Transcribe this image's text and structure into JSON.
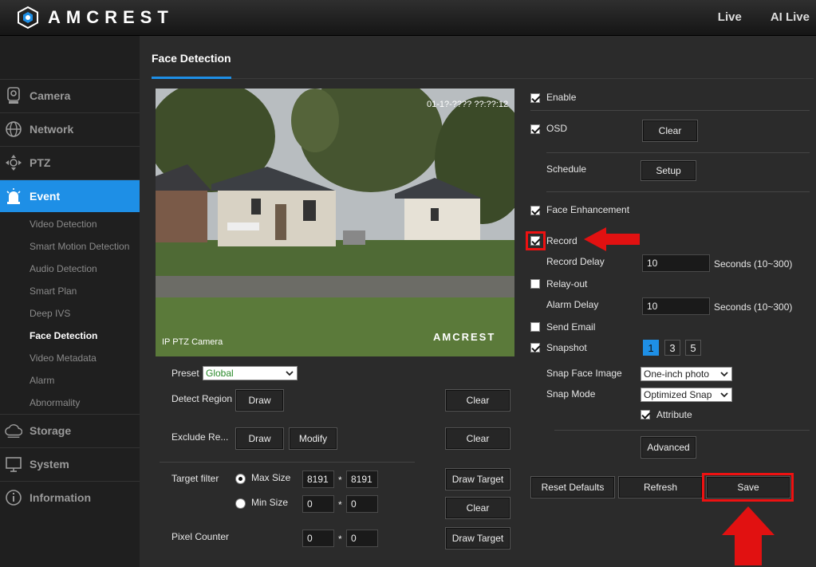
{
  "brand": "AMCREST",
  "top_nav": [
    "Live",
    "AI Live"
  ],
  "sidebar": {
    "main": [
      {
        "label": "Camera",
        "icon": "camera-icon"
      },
      {
        "label": "Network",
        "icon": "globe-icon"
      },
      {
        "label": "PTZ",
        "icon": "ptz-icon"
      },
      {
        "label": "Event",
        "icon": "alarm-icon",
        "active": true
      },
      {
        "label": "Storage",
        "icon": "cloud-icon"
      },
      {
        "label": "System",
        "icon": "monitor-icon"
      },
      {
        "label": "Information",
        "icon": "info-icon"
      }
    ],
    "sub": [
      "Video Detection",
      "Smart Motion Detection",
      "Audio Detection",
      "Smart Plan",
      "Deep IVS",
      "Face Detection",
      "Video Metadata",
      "Alarm",
      "Abnormality"
    ],
    "active_sub": "Face Detection"
  },
  "tab": "Face Detection",
  "video": {
    "timestamp": "01-1?-???? ??:??:12",
    "caption": "IP PTZ Camera",
    "watermark": "AMCREST"
  },
  "left": {
    "preset_label": "Preset",
    "preset_value": "Global",
    "detect_region_label": "Detect Region",
    "exclude_region_label": "Exclude Re...",
    "draw": "Draw",
    "modify": "Modify",
    "clear": "Clear",
    "target_filter_label": "Target filter",
    "max_size_label": "Max Size",
    "min_size_label": "Min Size",
    "max_w": "8191",
    "max_h": "8191",
    "min_w": "0",
    "min_h": "0",
    "times": "*",
    "draw_target": "Draw Target",
    "pixel_counter_label": "Pixel Counter",
    "pc_w": "0",
    "pc_h": "0"
  },
  "right": {
    "enable": {
      "label": "Enable",
      "checked": true
    },
    "osd": {
      "label": "OSD",
      "checked": true
    },
    "clear": "Clear",
    "schedule_label": "Schedule",
    "setup": "Setup",
    "face_enhancement": {
      "label": "Face Enhancement",
      "checked": true
    },
    "record": {
      "label": "Record",
      "checked": true
    },
    "record_delay_label": "Record Delay",
    "record_delay": "10",
    "seconds": "Seconds (10~300)",
    "relay_out": {
      "label": "Relay-out",
      "checked": false
    },
    "alarm_delay_label": "Alarm Delay",
    "alarm_delay": "10",
    "send_email": {
      "label": "Send Email",
      "checked": false
    },
    "snapshot": {
      "label": "Snapshot",
      "checked": true
    },
    "snapshot_counts": [
      "1",
      "3",
      "5"
    ],
    "snap_face_image_label": "Snap Face Image",
    "snap_face_image": "One-inch photo",
    "snap_mode_label": "Snap Mode",
    "snap_mode": "Optimized Snap",
    "attribute": {
      "label": "Attribute",
      "checked": true
    },
    "advanced": "Advanced"
  },
  "footer": {
    "reset": "Reset Defaults",
    "refresh": "Refresh",
    "save": "Save"
  },
  "colors": {
    "accent": "#1e8fe6",
    "annotation": "#e11111"
  }
}
